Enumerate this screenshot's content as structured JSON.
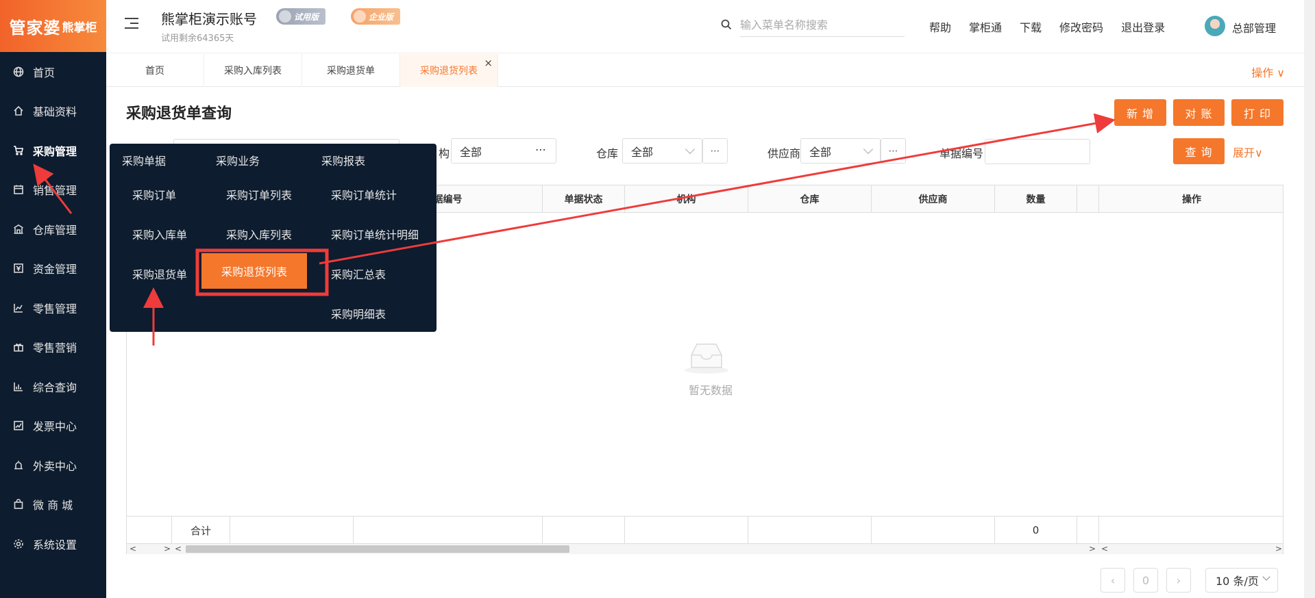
{
  "logo": {
    "main": "管家婆",
    "sub": "熊掌柜"
  },
  "sidebar": {
    "items": [
      {
        "label": "首页",
        "icon": "globe-icon"
      },
      {
        "label": "基础资料",
        "icon": "home-icon"
      },
      {
        "label": "采购管理",
        "icon": "cart-icon",
        "active": true
      },
      {
        "label": "销售管理",
        "icon": "calendar-icon"
      },
      {
        "label": "仓库管理",
        "icon": "warehouse-icon"
      },
      {
        "label": "资金管理",
        "icon": "money-icon"
      },
      {
        "label": "零售管理",
        "icon": "line-chart-icon"
      },
      {
        "label": "零售营销",
        "icon": "gift-icon"
      },
      {
        "label": "综合查询",
        "icon": "bar-chart-icon"
      },
      {
        "label": "发票中心",
        "icon": "trend-icon"
      },
      {
        "label": "外卖中心",
        "icon": "alarm-icon"
      },
      {
        "label": "微 商 城",
        "icon": "bag-icon"
      },
      {
        "label": "系统设置",
        "icon": "gear-icon"
      }
    ]
  },
  "header": {
    "account_title": "熊掌柜演示账号",
    "account_sub": "试用剩余64365天",
    "badge_trial": "试用版",
    "badge_enterprise": "企业版",
    "search_placeholder": "输入菜单名称搜索",
    "links": [
      "帮助",
      "掌柜通",
      "下载",
      "修改密码",
      "退出登录"
    ],
    "username": "总部管理"
  },
  "tabs": {
    "items": [
      "首页",
      "采购入库列表",
      "采购退货单",
      "采购退货列表"
    ],
    "active_index": 3,
    "close": "×",
    "ops": "操作 ∨"
  },
  "page": {
    "title": "采购退货单查询",
    "buttons": {
      "add": "新 增",
      "reconcile": "对 账",
      "print": "打 印",
      "query": "查 询"
    },
    "expand": "展开∨",
    "filters": {
      "org_label": "构",
      "org_value": "全部",
      "warehouse_label": "仓库",
      "warehouse_value": "全部",
      "supplier_label": "供应商",
      "supplier_value": "全部",
      "docno_label": "单据编号"
    },
    "dots": "⋯"
  },
  "table": {
    "columns": [
      "据编号",
      "单据状态",
      "机构",
      "仓库",
      "供应商",
      "数量",
      "操作"
    ],
    "empty_text": "暂无数据",
    "footer": {
      "label": "合计",
      "qty": "0"
    }
  },
  "pagination": {
    "page": "0",
    "page_size": "10 条/页",
    "prev": "‹",
    "next": "›"
  },
  "mega_menu": {
    "headers": [
      "采购单据",
      "采购业务",
      "采购报表"
    ],
    "col1": [
      "采购订单",
      "采购入库单",
      "采购退货单"
    ],
    "col2": [
      "采购订单列表",
      "采购入库列表",
      "采购退货列表"
    ],
    "col3": [
      "采购订单统计",
      "采购订单统计明细",
      "采购汇总表",
      "采购明细表"
    ]
  },
  "colors": {
    "accent": "#f5772b",
    "sidebar": "#0d1c2e",
    "annotation": "#ef3b3b"
  }
}
